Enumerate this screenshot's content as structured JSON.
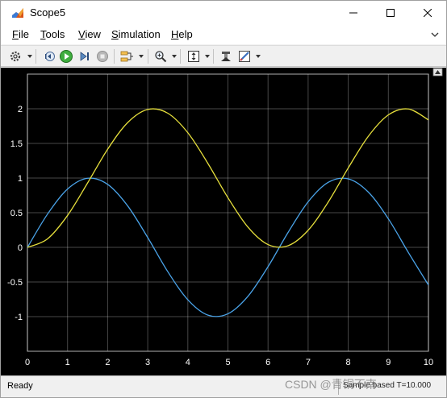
{
  "window": {
    "title": "Scope5"
  },
  "menu": {
    "items": [
      {
        "first": "F",
        "rest": "ile"
      },
      {
        "first": "T",
        "rest": "ools"
      },
      {
        "first": "V",
        "rest": "iew"
      },
      {
        "first": "S",
        "rest": "imulation"
      },
      {
        "first": "H",
        "rest": "elp"
      }
    ]
  },
  "toolbar": {
    "icons": [
      "gear-icon",
      "step-back-icon",
      "run-icon",
      "step-forward-icon",
      "stop-icon",
      "signal-select-icon",
      "zoom-icon",
      "autoscale-icon",
      "highlight-icon",
      "style-icon"
    ]
  },
  "status": {
    "ready": "Ready",
    "right": "Sample based  T=10.000"
  },
  "watermark": "CSDN @青铜不南",
  "colors": {
    "series1": "#0072BD",
    "series2": "#EDB120",
    "plot_bg": "#000000",
    "axes_bg": "#000000",
    "grid": "#ffffff",
    "tick_text": "#ffffff"
  },
  "chart_data": {
    "type": "line",
    "xlim": [
      0,
      10
    ],
    "ylim": [
      -1.5,
      2.5
    ],
    "x_ticks": [
      0,
      1,
      2,
      3,
      4,
      5,
      6,
      7,
      8,
      9,
      10
    ],
    "y_ticks": [
      -1,
      -0.5,
      0,
      0.5,
      1,
      1.5,
      2
    ],
    "x_tick_labels": [
      "0",
      "1",
      "2",
      "3",
      "4",
      "5",
      "6",
      "7",
      "8",
      "9",
      "10"
    ],
    "y_tick_labels": [
      "-1",
      "-0.5",
      "0",
      "0.5",
      "1",
      "1.5",
      "2"
    ],
    "grid": true,
    "x": [
      0,
      0.5,
      1,
      1.5,
      2,
      2.5,
      3,
      3.5,
      4,
      4.5,
      5,
      5.5,
      6,
      6.5,
      7,
      7.5,
      8,
      8.5,
      9,
      9.5,
      10
    ],
    "series": [
      {
        "color": "#4aa3e8",
        "values": [
          0,
          0.479,
          0.841,
          0.997,
          0.909,
          0.598,
          0.141,
          -0.351,
          -0.757,
          -0.978,
          -0.959,
          -0.706,
          -0.279,
          0.215,
          0.657,
          0.938,
          0.989,
          0.798,
          0.412,
          -0.075,
          -0.544
        ]
      },
      {
        "color": "#e6df3c",
        "values": [
          0,
          0.122,
          0.46,
          0.929,
          1.416,
          1.801,
          1.99,
          1.936,
          1.654,
          1.211,
          0.716,
          0.291,
          0.04,
          0.024,
          0.246,
          0.653,
          1.146,
          1.602,
          1.911,
          1.997,
          1.839
        ]
      }
    ]
  }
}
